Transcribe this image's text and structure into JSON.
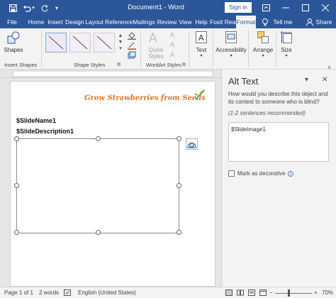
{
  "titlebar": {
    "title": "Document1 - Word",
    "signin": "Sign in"
  },
  "tabs": [
    {
      "label": "File"
    },
    {
      "label": "Home"
    },
    {
      "label": "Insert"
    },
    {
      "label": "Design"
    },
    {
      "label": "Layout"
    },
    {
      "label": "Reference"
    },
    {
      "label": "Mailings"
    },
    {
      "label": "Review"
    },
    {
      "label": "View"
    },
    {
      "label": "Help"
    },
    {
      "label": "Foxit Reac"
    },
    {
      "label": "Format"
    }
  ],
  "tellme": "Tell me",
  "share": "Share",
  "ribbon": {
    "shapes_label": "Shapes",
    "insert_shapes": "Insert Shapes",
    "shape_styles": "Shape Styles",
    "quick_styles": "Quick Styles",
    "wordart_styles": "WordArt Styles",
    "text": "Text",
    "accessibility": "Accessibility",
    "arrange": "Arrange",
    "size": "Size"
  },
  "document": {
    "title": "Grow Strawberries from Seeds",
    "slide_name": "$SlideName1",
    "slide_description": "$SlideDescription1"
  },
  "alt_text": {
    "title": "Alt Text",
    "question": "How would you describe this object and its context to someone who is blind?",
    "hint": "(1-2 sentences recommended)",
    "value": "$SlideImage1",
    "decorative_label": "Mark as decorative"
  },
  "status": {
    "page": "Page 1 of 1",
    "words": "2 words",
    "language": "English (United States)",
    "zoom": "70%"
  },
  "colors": {
    "accent": "#2b579a",
    "title_text": "#e4711e"
  }
}
